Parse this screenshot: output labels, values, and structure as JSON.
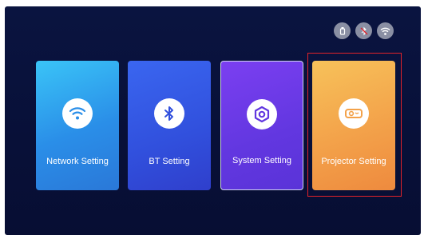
{
  "status_bar": {
    "icons": [
      "usb-icon",
      "bluetooth-off-icon",
      "wifi-icon"
    ]
  },
  "cards": [
    {
      "label": "Network Setting",
      "icon": "wifi-icon",
      "color": "#2a8ee8"
    },
    {
      "label": "BT Setting",
      "icon": "bluetooth-icon",
      "color": "#3150dd"
    },
    {
      "label": "System Setting",
      "icon": "hexagon-gear-icon",
      "color": "#6237e0"
    },
    {
      "label": "Projector Setting",
      "icon": "projector-icon",
      "color": "#f3a24a"
    }
  ],
  "selected_card": "Projector Setting",
  "colors": {
    "background": "#081038",
    "selection": "#e0222a",
    "status_icon": "#8a8fa3"
  }
}
